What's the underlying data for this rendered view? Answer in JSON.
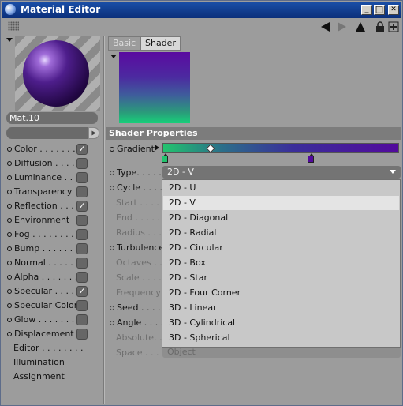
{
  "window": {
    "title": "Material Editor"
  },
  "titlebar_buttons": {
    "minimize": "_",
    "maximize": "□",
    "close": "✕"
  },
  "material": {
    "name": "Mat.10"
  },
  "channels": [
    {
      "label": "Color . . . . . . . .",
      "checked": true,
      "has_dot": true
    },
    {
      "label": "Diffusion . . . . . .",
      "checked": false,
      "has_dot": true
    },
    {
      "label": "Luminance . . . . .",
      "checked": false,
      "has_dot": true
    },
    {
      "label": "Transparency",
      "checked": false,
      "has_dot": true
    },
    {
      "label": "Reflection . . . . .",
      "checked": true,
      "has_dot": true
    },
    {
      "label": "Environment",
      "checked": false,
      "has_dot": true
    },
    {
      "label": "Fog . . . . . . . . .",
      "checked": false,
      "has_dot": true
    },
    {
      "label": "Bump . . . . . . . .",
      "checked": false,
      "has_dot": true
    },
    {
      "label": "Normal . . . . . . .",
      "checked": false,
      "has_dot": true
    },
    {
      "label": "Alpha . . . . . . . .",
      "checked": false,
      "has_dot": true
    },
    {
      "label": "Specular . . . . . .",
      "checked": true,
      "has_dot": true
    },
    {
      "label": "Specular Color",
      "checked": false,
      "has_dot": true
    },
    {
      "label": "Glow . . . . . . . . .",
      "checked": false,
      "has_dot": true
    },
    {
      "label": "Displacement",
      "checked": false,
      "has_dot": true
    },
    {
      "label": "Editor . . . . . . . .",
      "checked": null,
      "has_dot": false
    },
    {
      "label": "Illumination",
      "checked": null,
      "has_dot": false
    },
    {
      "label": "Assignment",
      "checked": null,
      "has_dot": false
    }
  ],
  "checkmark": "✓",
  "tabs": {
    "basic": "Basic",
    "shader": "Shader"
  },
  "section": {
    "title": "Shader Properties"
  },
  "props": {
    "gradient": "Gradient",
    "type": "Type. . . . . .",
    "cycle": "Cycle . . . . .",
    "start": "Start . . . . .",
    "end": "End . . . . . .",
    "radius": "Radius . . . .",
    "turbulence": "Turbulence",
    "octaves": "Octaves . . .",
    "scale": "Scale . . . . .",
    "frequency": "Frequency",
    "seed": "Seed . . . . . .",
    "angle": "Angle . . . . .",
    "absolute": "Absolute. . .",
    "space": "Space . . . ."
  },
  "type_select": {
    "value": "2D - V"
  },
  "type_options": [
    "2D - U",
    "2D - V",
    "2D - Diagonal",
    "2D - Radial",
    "2D - Circular",
    "2D - Box",
    "2D - Star",
    "2D - Four Corner",
    "3D - Linear",
    "3D - Cylindrical",
    "3D - Spherical"
  ],
  "type_selected_index": 1,
  "space_select": {
    "value": "Object"
  },
  "colors": {
    "accent_purple": "#520a9c",
    "accent_green": "#22c46e",
    "titlebar": "#0b2f7a"
  }
}
